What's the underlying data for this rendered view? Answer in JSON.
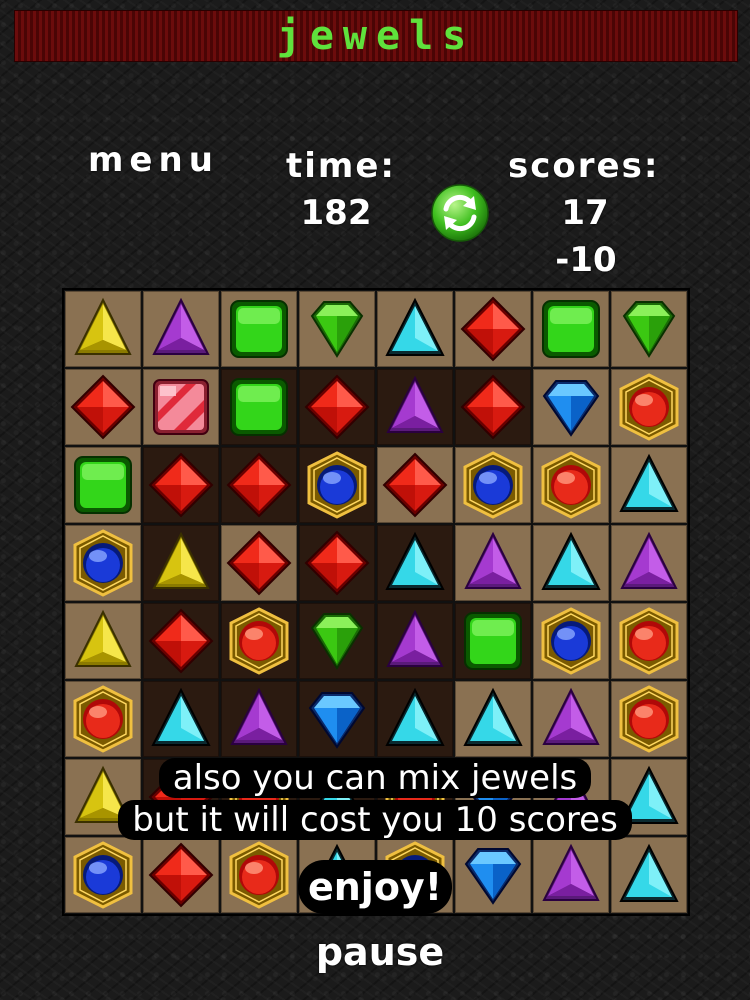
{
  "title": "jewels",
  "hud": {
    "menu_label": "menu",
    "time_label": "time:",
    "time_value": "182",
    "score_label": "scores:",
    "score_value": "17",
    "score_delta": "-10",
    "refresh_icon": "refresh-icon"
  },
  "colors": {
    "title_green": "#5fe23c",
    "titlebar_red": "#5a0808",
    "cell_light": "#8a7152",
    "cell_dark": "#2b1a10"
  },
  "board": {
    "rows": 8,
    "cols": 8,
    "cells": [
      [
        "yellow-triangle",
        "purple-triangle",
        "green-square",
        "green-diamond",
        "cyan-triangle",
        "red-rhombus",
        "green-square",
        "green-diamond"
      ],
      [
        "red-rhombus",
        "pink-square",
        "green-square",
        "red-rhombus",
        "purple-triangle",
        "red-rhombus",
        "blue-diamond",
        "red-orb"
      ],
      [
        "green-square",
        "red-rhombus",
        "red-rhombus",
        "blue-orb",
        "red-rhombus",
        "blue-orb",
        "red-orb",
        "cyan-triangle"
      ],
      [
        "blue-orb",
        "yellow-triangle",
        "red-rhombus",
        "red-rhombus",
        "cyan-triangle",
        "purple-triangle",
        "cyan-triangle",
        "purple-triangle"
      ],
      [
        "yellow-triangle",
        "red-rhombus",
        "red-orb",
        "green-diamond",
        "purple-triangle",
        "green-square",
        "blue-orb",
        "red-orb"
      ],
      [
        "red-orb",
        "cyan-triangle",
        "purple-triangle",
        "blue-diamond",
        "cyan-triangle",
        "cyan-triangle",
        "purple-triangle",
        "red-orb"
      ],
      [
        "yellow-triangle",
        "red-rhombus",
        "red-orb",
        "cyan-triangle",
        "red-orb",
        "blue-diamond",
        "purple-triangle",
        "cyan-triangle"
      ],
      [
        "blue-orb",
        "red-rhombus",
        "red-orb",
        "cyan-triangle",
        "blue-orb",
        "blue-diamond",
        "purple-triangle",
        "cyan-triangle"
      ]
    ],
    "shading": [
      [
        "light",
        "light",
        "light",
        "light",
        "light",
        "light",
        "light",
        "light"
      ],
      [
        "light",
        "light",
        "dark",
        "dark",
        "dark",
        "dark",
        "light",
        "light"
      ],
      [
        "light",
        "dark",
        "dark",
        "dark",
        "light",
        "light",
        "light",
        "light"
      ],
      [
        "light",
        "dark",
        "light",
        "dark",
        "dark",
        "light",
        "light",
        "light"
      ],
      [
        "light",
        "dark",
        "dark",
        "dark",
        "dark",
        "dark",
        "light",
        "light"
      ],
      [
        "light",
        "dark",
        "dark",
        "dark",
        "dark",
        "light",
        "light",
        "light"
      ],
      [
        "light",
        "dark",
        "dark",
        "dark",
        "dark",
        "light",
        "light",
        "light"
      ],
      [
        "light",
        "light",
        "light",
        "light",
        "light",
        "light",
        "light",
        "light"
      ]
    ]
  },
  "tutorial": {
    "line1": "also you can mix jewels",
    "line2": "but it will cost you 10 scores",
    "line3": "enjoy!"
  },
  "pause_label": "pause"
}
